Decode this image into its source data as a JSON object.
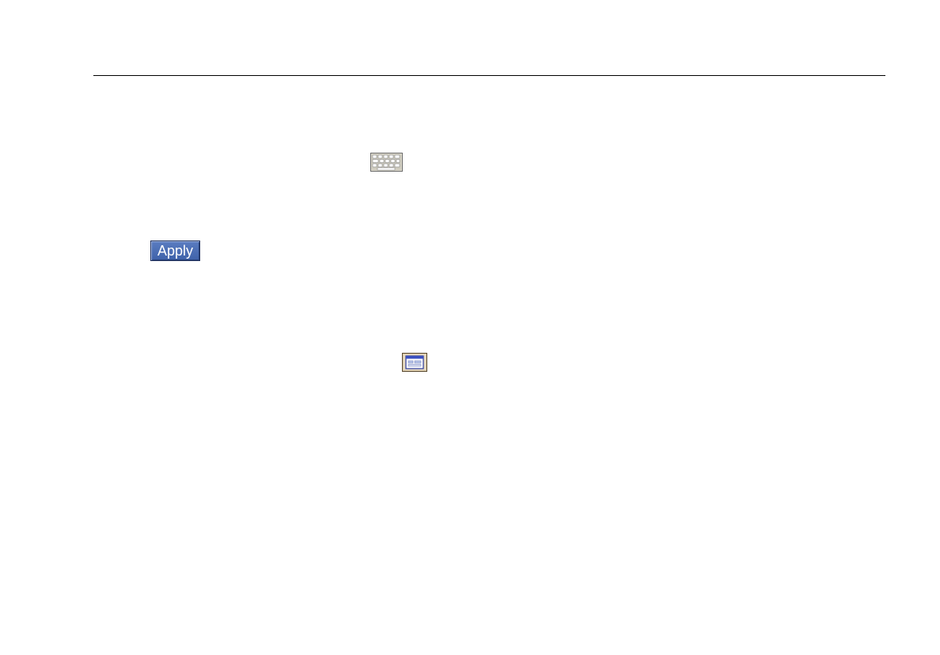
{
  "icons": {
    "keyboard": "keyboard-icon",
    "window": "window-icon"
  },
  "apply_button": {
    "label": "Apply"
  },
  "colors": {
    "rule": "#000000",
    "apply_bg": "#4a6db5",
    "apply_text": "#ffffff"
  }
}
